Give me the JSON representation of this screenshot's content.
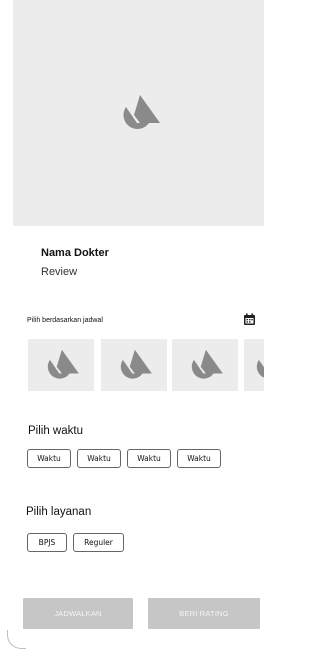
{
  "doctor": {
    "name": "Nama Dokter",
    "review": "Review"
  },
  "schedule": {
    "label": "Pilih berdasarkan jadwal",
    "calendar_icon": "calendar-icon"
  },
  "time": {
    "title": "Pilih waktu",
    "options": [
      "Waktu",
      "Waktu",
      "Waktu",
      "Waktu"
    ]
  },
  "service": {
    "title": "Pilih layanan",
    "options": [
      "BPJS",
      "Reguler"
    ]
  },
  "actions": {
    "schedule_button": "JADWALKAN",
    "rating_button": "BERI RATING"
  },
  "colors": {
    "placeholder_bg": "#ececec",
    "placeholder_icon": "#8a8a8a",
    "button_bg": "#c6c6c6"
  }
}
